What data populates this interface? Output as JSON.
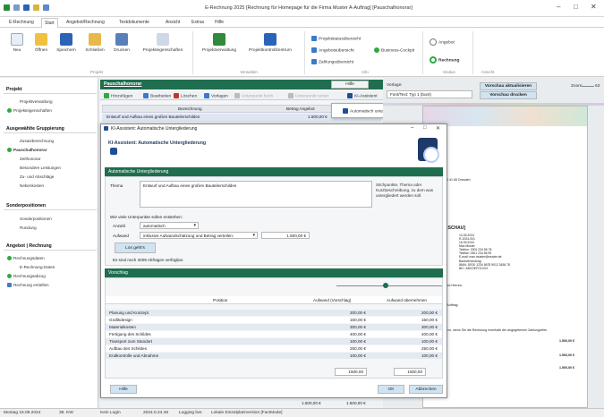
{
  "window": {
    "title": "E-Rechnung 2025 [Rechnung für Homepage für die Firma Muster A-Auftrag] [Pauschalhonorar]"
  },
  "menu": {
    "items": [
      "E-Rechnung",
      "Start",
      "Angebot/Rechnung",
      "Textdokumente",
      "Ansicht",
      "Extras",
      "Hilfe"
    ],
    "active": "Start"
  },
  "ribbon": {
    "buttons": {
      "neu": "Neu",
      "oeffnen": "Öffnen",
      "speichern": "Speichern",
      "schliessen": "Schließen",
      "drucken": "Drucken",
      "projekteigenschaften": "Projekteigenschaften",
      "projektverwaltung": "Projektverwaltung",
      "projektkontrollzentrum": "Projektkontrollzentrum"
    },
    "groups": {
      "projekt": "Projekt",
      "verwalten": "Verwalten",
      "info": "Info",
      "modus": "Modus",
      "ansicht": "Ansicht"
    },
    "info_links": {
      "status": "Projektstatusübersicht",
      "angebot": "Angebotsübersicht",
      "zahlung": "Zahlungsübersicht",
      "cockpit": "Business-Cockpit"
    },
    "modus": {
      "angebot": "Angebot",
      "rechnung": "Rechnung"
    }
  },
  "sidebar": {
    "sections": [
      {
        "title": "Projekt",
        "items": [
          "Projektverwaltung",
          "Projekteigenschaften"
        ]
      },
      {
        "title": "Ausgewählte Gruppierung",
        "items": [
          "Zusatzberechnung",
          "Pauschalhonorar",
          "Zeithonorar",
          "Besondere Leistungen",
          "Zu- und Abschläge",
          "Nebenkosten"
        ]
      },
      {
        "title": "Sonderpositionen",
        "items": [
          "Sonderpositionen",
          "Rundung"
        ]
      },
      {
        "title": "Angebot | Rechnung",
        "items": [
          "Rechnungsdaten",
          "E-Rechnung-Daten",
          "Rechnungsabzug",
          "Rechnung erstellen"
        ]
      }
    ]
  },
  "pauschal_panel": {
    "title": "Pauschalhonorar",
    "help": "Hilfe",
    "toolbar": {
      "hinzufuegen": "Hinzufügen",
      "bearbeiten": "Bearbeiten",
      "loeschen": "Löschen",
      "vorlagen": "Vorlagen",
      "unterpunkt_hoch": "Unterpunkt hoch",
      "unterpunkt_runter": "Unterpunkt runter",
      "ki_assistent": "KI-Assistent"
    },
    "columns": {
      "bezeichnung": "Bezeichnung",
      "betrag": "Betrag Angebot",
      "b": "B"
    },
    "row": {
      "text": "Entwurf und Aufbau eines großen Bauteilerschildes",
      "betrag": "1.500,00 €"
    },
    "ki_menu_item": "Automatisch untergliedern",
    "bottom_values": [
      "1.500,00 €",
      "1.500,00 €"
    ]
  },
  "right_panel": {
    "vorlage_label": "Vorlage:",
    "vorlage_value": "Font/Text: Typ 1 (bunt)",
    "vorschau_aktualisieren": "Vorschau aktualisieren",
    "vorschau_drucken": "Vorschau drucken",
    "zoom_label": "Zoom:",
    "zoom_value": "63"
  },
  "doc_preview": {
    "lines": [
      "33 41 65 Dresden",
      "RSCHAU]",
      "10.05.2024",
      "R-2024-001",
      "16.09.2024",
      "Max Muster",
      "Telefon: 0301 234 56 78",
      "Telefax: 0301 234 56 99",
      "E-mail: max.muster@muster.de",
      "Bankverbindung:",
      "IBAN: DE00 1234 5678 9012 3456 78",
      "BIC: ABCDEFG1XXX",
      "und Herren,",
      "r Auftrag:",
      "dern, wenn Sie die Rechnung innerhalb der angegebenen Zahlungsfrist.",
      "1.500,00 €",
      "1.500,00 €",
      "1.500,00 €"
    ]
  },
  "ki_dialog": {
    "title": "KI-Assistent: Automatische Untergliederung",
    "header": "KI-Assistent: Automatische Untergliederung",
    "section1": "Automatische Untergliederung",
    "thema_label": "Thema",
    "thema_value": "Entwurf und Aufbau eines großen Bauteilerschildes",
    "thema_hint": "Stichpunkte, Thema oder Kurzbeschreibung, zu dem was untergliedert werden soll.",
    "anzahl_question": "Wie viele Unterpunkte sollen entstehen:",
    "anzahl_label": "Anzahl",
    "anzahl_value": "automatisch",
    "aufwand_label": "Aufwand",
    "aufwand_value": "inklusive Aufwandschätzung und Betrag verteilen:",
    "aufwand_amount": "1.500,00 €",
    "los_button": "Los geht's",
    "remaining": "Es sind noch 2009 Abfragen verfügbar.",
    "section2": "Vorschlag",
    "table_headers": [
      "Position",
      "Aufwand (Vorschlag)",
      "Aufwand übernehmen"
    ],
    "rows": [
      {
        "position": "Planung und Konzept",
        "vorschlag": "200,00 €",
        "uebernehmen": "200,00 €"
      },
      {
        "position": "Grafikdesign",
        "vorschlag": "150,00 €",
        "uebernehmen": "150,00 €"
      },
      {
        "position": "Materialkosten",
        "vorschlag": "300,00 €",
        "uebernehmen": "300,00 €"
      },
      {
        "position": "Fertigung des Schildes",
        "vorschlag": "400,00 €",
        "uebernehmen": "400,00 €"
      },
      {
        "position": "Transport zum Standort",
        "vorschlag": "100,00 €",
        "uebernehmen": "100,00 €"
      },
      {
        "position": "Aufbau des Schildes",
        "vorschlag": "250,00 €",
        "uebernehmen": "250,00 €"
      },
      {
        "position": "Endkontrolle und Abnahme",
        "vorschlag": "100,00 €",
        "uebernehmen": "100,00 €"
      }
    ],
    "total_vorschlag": "1500,00",
    "total_uebernehmen": "1500,00",
    "hilfe_button": "Hilfe",
    "ok_button": "OK",
    "abbrechen_button": "Abbrechen"
  },
  "statusbar": {
    "date": "Montag 16.09.2024",
    "kw": "38. KW",
    "login": "Kein Login",
    "time": "2024.0.24.48",
    "logging": "Logging live",
    "version": "Lokale Einzelplatzversion [FactMode]"
  }
}
